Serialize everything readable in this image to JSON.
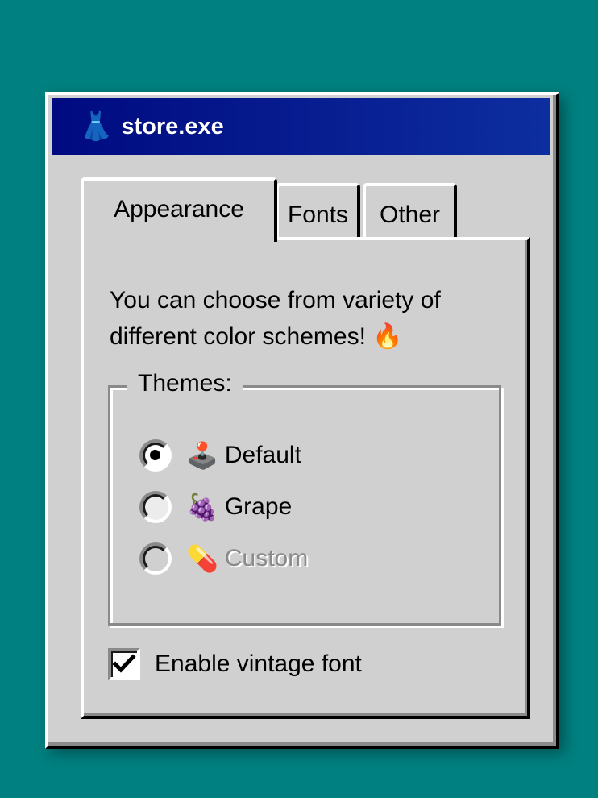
{
  "window": {
    "title": "store.exe",
    "title_icon": "dress-icon",
    "title_emoji": "👗"
  },
  "tabs": [
    {
      "label": "Appearance",
      "active": true
    },
    {
      "label": "Fonts",
      "active": false
    },
    {
      "label": "Other",
      "active": false
    }
  ],
  "appearance": {
    "description": "You can choose from variety of different color schemes! 🔥",
    "themes_legend": "Themes:",
    "themes": [
      {
        "emoji": "🕹️",
        "icon": "joystick-icon",
        "label": "Default",
        "checked": true,
        "disabled": false
      },
      {
        "emoji": "🍇",
        "icon": "grapes-icon",
        "label": "Grape",
        "checked": false,
        "disabled": false
      },
      {
        "emoji": "💊",
        "icon": "pill-icon",
        "label": "Custom",
        "checked": false,
        "disabled": true
      }
    ],
    "vintage_font": {
      "label": "Enable vintage font",
      "checked": true
    }
  },
  "colors": {
    "desktop": "#008080",
    "window_face": "#cfd0cf",
    "titlebar_start": "#000a80",
    "titlebar_end": "#0d2e9f"
  }
}
